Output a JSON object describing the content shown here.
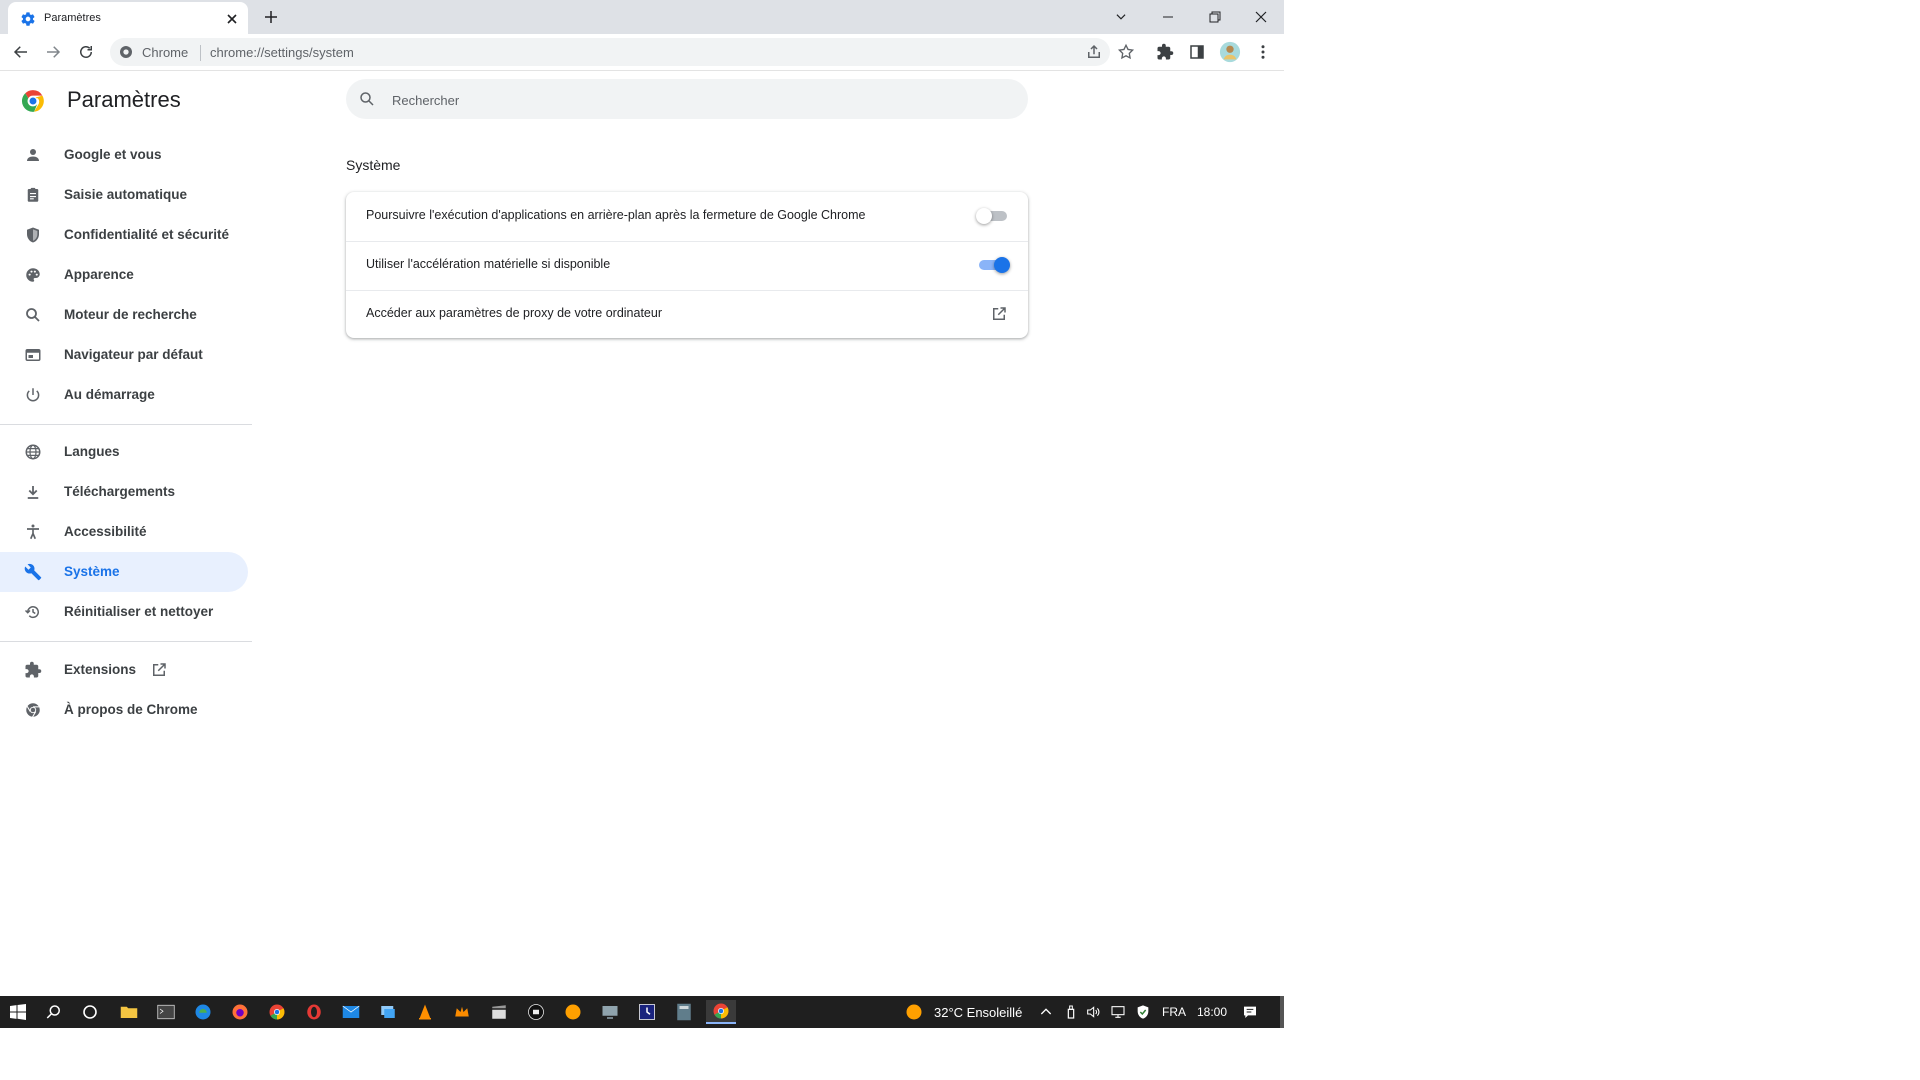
{
  "browser": {
    "tab": {
      "title": "Paramètres",
      "favicon": "gear-icon"
    },
    "omnibox": {
      "chip": "Chrome",
      "url": "chrome://settings/system"
    }
  },
  "page": {
    "title": "Paramètres",
    "search": {
      "placeholder": "Rechercher"
    }
  },
  "sidebar": {
    "items": [
      {
        "label": "Google et vous",
        "icon": "person-icon"
      },
      {
        "label": "Saisie automatique",
        "icon": "clipboard-icon"
      },
      {
        "label": "Confidentialité et sécurité",
        "icon": "shield-icon"
      },
      {
        "label": "Apparence",
        "icon": "palette-icon"
      },
      {
        "label": "Moteur de recherche",
        "icon": "search-icon"
      },
      {
        "label": "Navigateur par défaut",
        "icon": "browser-window-icon"
      },
      {
        "label": "Au démarrage",
        "icon": "power-icon"
      },
      {
        "label": "Langues",
        "icon": "globe-icon"
      },
      {
        "label": "Téléchargements",
        "icon": "download-icon"
      },
      {
        "label": "Accessibilité",
        "icon": "accessibility-icon"
      },
      {
        "label": "Système",
        "icon": "wrench-icon",
        "active": true
      },
      {
        "label": "Réinitialiser et nettoyer",
        "icon": "restore-icon"
      },
      {
        "label": "Extensions",
        "icon": "puzzle-icon"
      },
      {
        "label": "À propos de Chrome",
        "icon": "chrome-icon"
      }
    ]
  },
  "section": {
    "title": "Système",
    "rows": [
      {
        "label": "Poursuivre l'exécution d'applications en arrière-plan après la fermeture de Google Chrome",
        "control": "toggle",
        "enabled": false
      },
      {
        "label": "Utiliser l'accélération matérielle si disponible",
        "control": "toggle",
        "enabled": true
      },
      {
        "label": "Accéder aux paramètres de proxy de votre ordinateur",
        "control": "external-link"
      }
    ]
  },
  "taskbar": {
    "weather": "32°C  Ensoleillé",
    "language": "FRA",
    "time": "18:00"
  },
  "colors": {
    "accent": "#1a73e8",
    "active_nav_bg": "#e8f0fe",
    "taskbar": "#1f1f1f"
  }
}
